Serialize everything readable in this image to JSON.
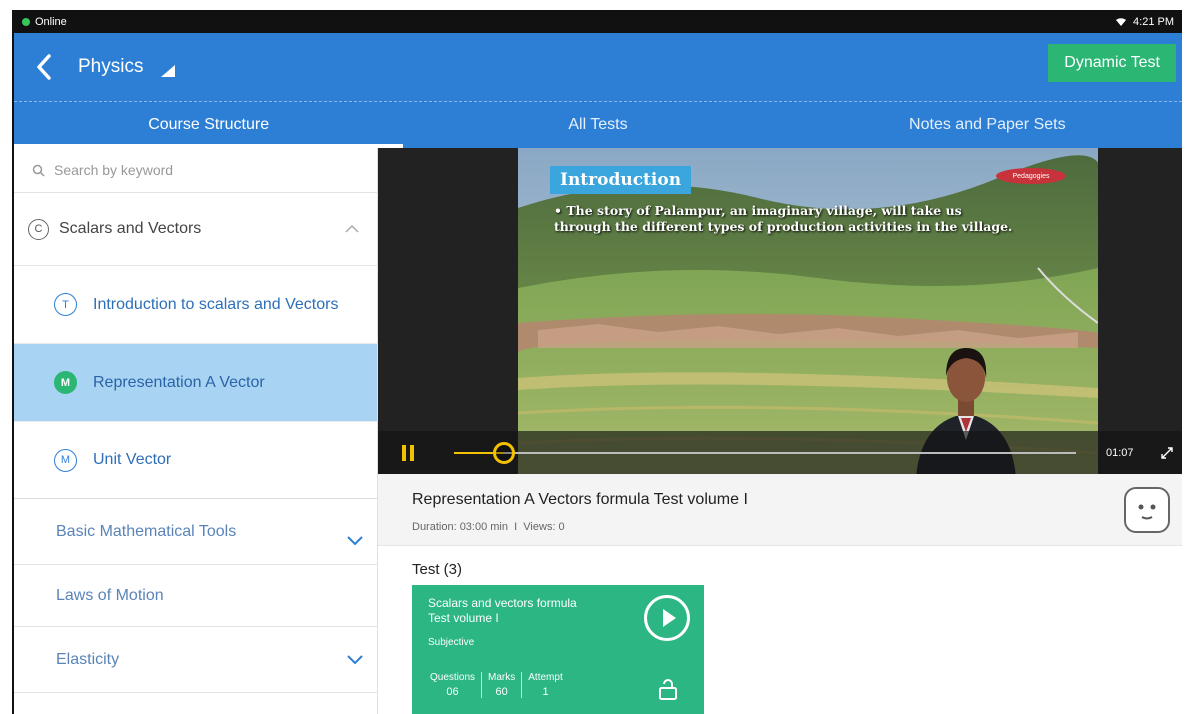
{
  "status_bar": {
    "network": "Online",
    "time": "4:21 PM"
  },
  "header": {
    "title": "Physics",
    "action_button": "Dynamic Test"
  },
  "tabs": [
    {
      "label": "Course Structure",
      "active": true
    },
    {
      "label": "All Tests",
      "active": false
    },
    {
      "label": "Notes and Paper Sets",
      "active": false
    }
  ],
  "sidebar": {
    "search_placeholder": "Search by keyword",
    "chapter": {
      "badge": "C",
      "label": "Scalars and Vectors"
    },
    "topics": [
      {
        "badge": "T",
        "label": "Introduction to scalars and Vectors",
        "selected": false
      },
      {
        "badge": "M",
        "label": "Representation A Vector",
        "selected": true
      },
      {
        "badge": "M",
        "label": "Unit Vector",
        "selected": false
      }
    ],
    "sections": [
      {
        "label": "Basic Mathematical Tools",
        "expandable": true
      },
      {
        "label": "Laws of Motion",
        "expandable": false
      },
      {
        "label": "Elasticity",
        "expandable": true
      }
    ]
  },
  "video": {
    "slide_heading": "Introduction",
    "slide_text": "The story of Palampur, an imaginary village, will take us through the different types of production activities in the village.",
    "logo_text": "Pedagogies",
    "elapsed": "01:07",
    "progress": 0.08
  },
  "lesson": {
    "title": "Representation A Vectors formula Test volume I",
    "duration_label": "Duration: 03:00 min",
    "views_label": "Views: 0"
  },
  "tests": {
    "header": "Test (3)",
    "card": {
      "title_line1": "Scalars and vectors formula",
      "title_line2": "Test volume I",
      "type": "Subjective",
      "stats": [
        {
          "label": "Questions",
          "value": "06"
        },
        {
          "label": "Marks",
          "value": "60"
        },
        {
          "label": "Attempt",
          "value": "1"
        }
      ]
    }
  },
  "colors": {
    "primary": "#2d7fd6",
    "accent_green": "#2bb673",
    "selected_row": "#a9d3f3",
    "player_progress": "#f2c200"
  }
}
